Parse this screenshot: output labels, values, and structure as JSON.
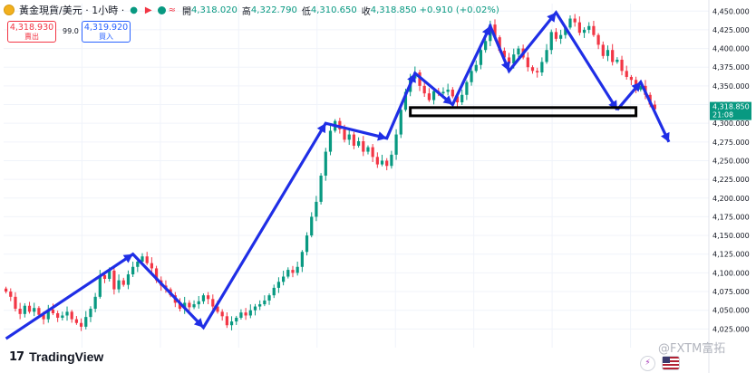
{
  "header": {
    "symbol": "黃金現貨/美元 · 1小時 ·",
    "open_label": "開",
    "open": "4,318.020",
    "high_label": "高",
    "high": "4,322.790",
    "low_label": "低",
    "low": "4,310.650",
    "close_label": "收",
    "close": "4,318.850",
    "change": "+0.910 (+0.02%)"
  },
  "trade": {
    "sell_price": "4,318.930",
    "sell_label": "賣出",
    "spread": "99.0",
    "buy_price": "4,319.920",
    "buy_label": "買入"
  },
  "price_tag": {
    "price": "4,318.850",
    "countdown": "21:08"
  },
  "branding": {
    "logo_mark": "17",
    "logo": "TradingView",
    "watermark": "@FXTM富拓"
  },
  "colors": {
    "up": "#089981",
    "down": "#f23645",
    "arrow": "#1f2ee6",
    "tag": "#089981"
  },
  "chart_data": {
    "type": "candlestick",
    "ylim": [
      4000,
      4460
    ],
    "yticks": [
      4025,
      4050,
      4075,
      4100,
      4125,
      4150,
      4175,
      4200,
      4225,
      4250,
      4275,
      4300,
      4325,
      4350,
      4375,
      4400,
      4425,
      4450
    ],
    "ytick_labels": [
      "4,025.000",
      "4,050.000",
      "4,075.000",
      "4,100.000",
      "4,125.000",
      "4,150.000",
      "4,175.000",
      "4,200.000",
      "4,225.000",
      "4,250.000",
      "4,275.000",
      "4,300.000",
      "4,325.000",
      "4,350.000",
      "4,375.000",
      "4,400.000",
      "4,425.000",
      "4,450.000"
    ],
    "grid": true,
    "closes": [
      4075,
      4068,
      4052,
      4045,
      4056,
      4048,
      4053,
      4044,
      4038,
      4051,
      4046,
      4040,
      4043,
      4048,
      4038,
      4033,
      4028,
      4041,
      4052,
      4068,
      4097,
      4092,
      4103,
      4078,
      4090,
      4084,
      4098,
      4108,
      4115,
      4122,
      4113,
      4106,
      4090,
      4083,
      4078,
      4070,
      4060,
      4052,
      4060,
      4054,
      4058,
      4062,
      4070,
      4065,
      4055,
      4048,
      4042,
      4030,
      4035,
      4040,
      4047,
      4043,
      4050,
      4055,
      4058,
      4063,
      4070,
      4080,
      4088,
      4095,
      4104,
      4100,
      4108,
      4128,
      4150,
      4175,
      4195,
      4230,
      4262,
      4290,
      4303,
      4292,
      4278,
      4285,
      4270,
      4276,
      4262,
      4268,
      4255,
      4245,
      4250,
      4243,
      4258,
      4285,
      4318,
      4342,
      4360,
      4368,
      4350,
      4340,
      4331,
      4343,
      4340,
      4342,
      4345,
      4336,
      4328,
      4338,
      4355,
      4370,
      4378,
      4398,
      4410,
      4432,
      4415,
      4397,
      4388,
      4380,
      4392,
      4400,
      4388,
      4375,
      4370,
      4368,
      4382,
      4398,
      4422,
      4413,
      4418,
      4428,
      4440,
      4435,
      4421,
      4425,
      4430,
      4418,
      4405,
      4390,
      4398,
      4382,
      4385,
      4370,
      4362,
      4358,
      4345,
      4350,
      4338,
      4325,
      4318.85
    ],
    "annotations": {
      "zigzag_arrow": [
        [
          0,
          4012
        ],
        [
          27,
          4125
        ],
        [
          42,
          4027
        ],
        [
          68,
          4300
        ],
        [
          81,
          4280
        ],
        [
          87,
          4367
        ],
        [
          95,
          4325
        ],
        [
          103,
          4430
        ],
        [
          107,
          4370
        ],
        [
          117,
          4448
        ],
        [
          130,
          4318
        ]
      ],
      "forecast_arrow": [
        [
          130,
          4318
        ],
        [
          135,
          4355
        ],
        [
          141,
          4275
        ]
      ],
      "zone": {
        "from": 86,
        "to": 134,
        "high": 4321,
        "low": 4310
      }
    }
  }
}
